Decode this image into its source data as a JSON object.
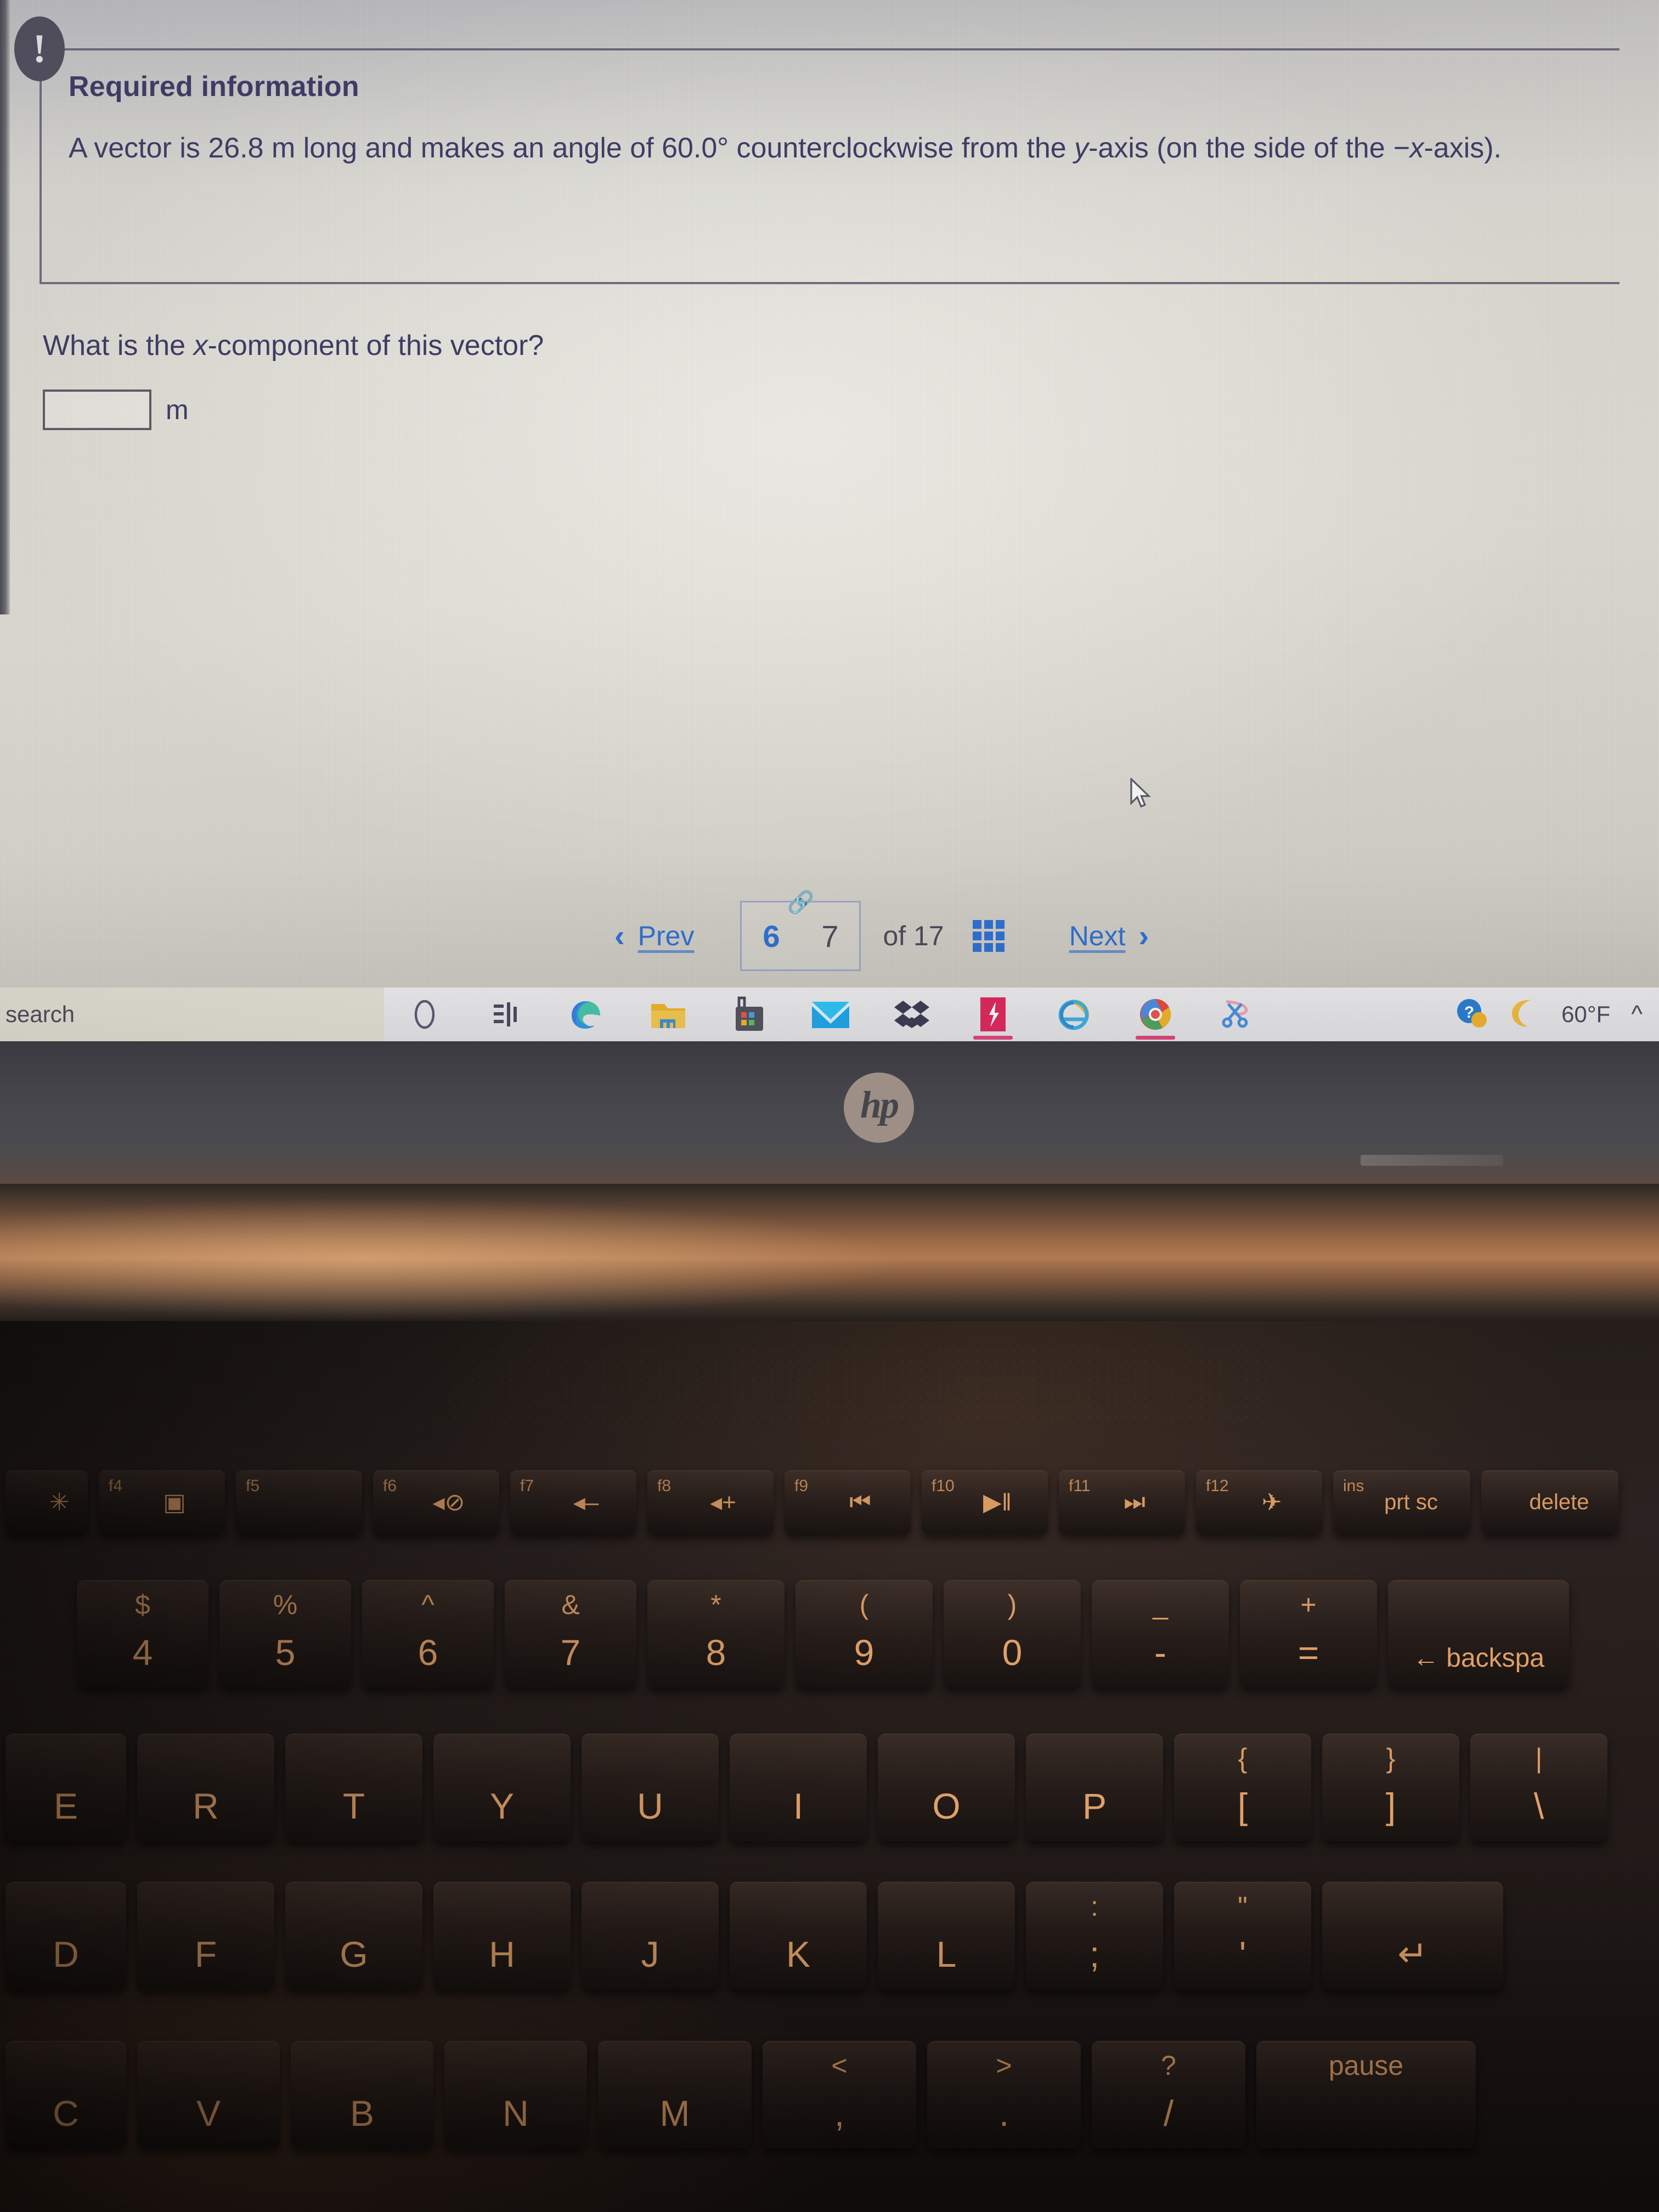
{
  "screen": {
    "callout": {
      "badge": "!",
      "title": "Required information",
      "body_pre": "A vector is 26.8 m long and makes an angle of 60.0° counterclockwise from the ",
      "body_italic1": "y",
      "body_mid": "-axis (on the side of the ",
      "body_italic2": "−x",
      "body_end": "-axis)."
    },
    "question": {
      "prompt_pre": "What is the ",
      "prompt_italic": "x",
      "prompt_post": "-component of this vector?",
      "answer_value": "",
      "answer_placeholder": "",
      "unit_label": "m"
    },
    "pagination": {
      "prev_label": "Prev",
      "prev_icon": "chevron-left-icon",
      "current_page": "6",
      "alt_page": "7",
      "link_icon": "link-chain-icon",
      "of_label": "of 17",
      "grid_icon": "grid-view-icon",
      "next_label": "Next",
      "next_icon": "chevron-right-icon",
      "accent_color": "#2f6fd0"
    },
    "cursor": {
      "icon": "mouse-pointer-icon"
    }
  },
  "taskbar": {
    "search_text": "search",
    "search_icon": "magnifier-icon",
    "items": [
      {
        "name": "cortana-circle-icon",
        "label": ""
      },
      {
        "name": "task-view-icon",
        "label": ""
      },
      {
        "name": "edge-browser-icon",
        "label": ""
      },
      {
        "name": "file-explorer-icon",
        "label": ""
      },
      {
        "name": "microsoft-store-icon",
        "label": ""
      },
      {
        "name": "mail-icon",
        "label": ""
      },
      {
        "name": "dropbox-icon",
        "label": ""
      },
      {
        "name": "bitdefender-icon",
        "label": ""
      },
      {
        "name": "internet-explorer-icon",
        "label": ""
      },
      {
        "name": "chrome-browser-icon",
        "label": ""
      },
      {
        "name": "snipping-tool-icon",
        "label": ""
      }
    ],
    "tray": {
      "help_icon": "help-question-icon",
      "weather_icon": "moon-icon",
      "temperature": "60°F",
      "overflow_icon": "chevron-up-icon"
    }
  },
  "laptop": {
    "brand_logo": "hp",
    "bezel_label": ""
  },
  "keyboard": {
    "function_row": [
      {
        "sup": "",
        "glyph": "✳",
        "word": ""
      },
      {
        "sup": "f4",
        "glyph": "▣",
        "word": ""
      },
      {
        "sup": "f5",
        "glyph": "",
        "word": ""
      },
      {
        "sup": "f6",
        "glyph": "◂⊘",
        "word": ""
      },
      {
        "sup": "f7",
        "glyph": "◂–",
        "word": ""
      },
      {
        "sup": "f8",
        "glyph": "◂+",
        "word": ""
      },
      {
        "sup": "f9",
        "glyph": "⏮",
        "word": ""
      },
      {
        "sup": "f10",
        "glyph": "▶‖",
        "word": ""
      },
      {
        "sup": "f11",
        "glyph": "⏭",
        "word": ""
      },
      {
        "sup": "f12",
        "glyph": "✈",
        "word": ""
      },
      {
        "sup": "ins",
        "glyph": "",
        "word": "prt sc"
      },
      {
        "sup": "",
        "glyph": "",
        "word": "delete"
      }
    ],
    "number_row": [
      {
        "top": "$",
        "bot": "4"
      },
      {
        "top": "%",
        "bot": "5"
      },
      {
        "top": "^",
        "bot": "6"
      },
      {
        "top": "&",
        "bot": "7"
      },
      {
        "top": "*",
        "bot": "8"
      },
      {
        "top": "(",
        "bot": "9"
      },
      {
        "top": ")",
        "bot": "0"
      },
      {
        "top": "_",
        "bot": "-"
      },
      {
        "top": "+",
        "bot": "="
      },
      {
        "top": "",
        "bot": "← backspa"
      }
    ],
    "qwerty_row": [
      {
        "top": "",
        "bot": "E"
      },
      {
        "top": "",
        "bot": "R"
      },
      {
        "top": "",
        "bot": "T"
      },
      {
        "top": "",
        "bot": "Y"
      },
      {
        "top": "",
        "bot": "U"
      },
      {
        "top": "",
        "bot": "I"
      },
      {
        "top": "",
        "bot": "O"
      },
      {
        "top": "",
        "bot": "P"
      },
      {
        "top": "{",
        "bot": "["
      },
      {
        "top": "}",
        "bot": "]"
      },
      {
        "top": "|",
        "bot": "\\"
      }
    ],
    "home_row": [
      {
        "top": "",
        "bot": "D"
      },
      {
        "top": "",
        "bot": "F"
      },
      {
        "top": "",
        "bot": "G"
      },
      {
        "top": "",
        "bot": "H"
      },
      {
        "top": "",
        "bot": "J"
      },
      {
        "top": "",
        "bot": "K"
      },
      {
        "top": "",
        "bot": "L"
      },
      {
        "top": ":",
        "bot": ";"
      },
      {
        "top": "\"",
        "bot": "'"
      },
      {
        "top": "",
        "bot": "↵"
      }
    ],
    "bottom_row": [
      {
        "top": "",
        "bot": "C"
      },
      {
        "top": "",
        "bot": "V"
      },
      {
        "top": "",
        "bot": "B"
      },
      {
        "top": "",
        "bot": "N"
      },
      {
        "top": "",
        "bot": "M"
      },
      {
        "top": "<",
        "bot": ","
      },
      {
        "top": ">",
        "bot": "."
      },
      {
        "top": "?",
        "bot": "/"
      },
      {
        "top": "pause",
        "bot": ""
      }
    ]
  }
}
